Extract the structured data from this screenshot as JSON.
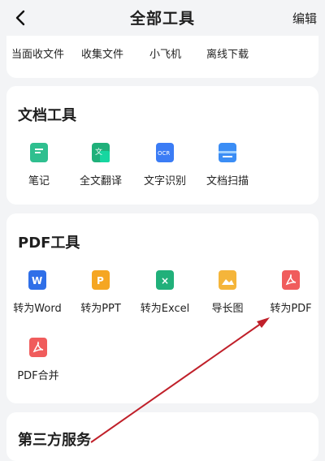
{
  "header": {
    "title": "全部工具",
    "edit_label": "编辑"
  },
  "top_row": [
    "当面收文件",
    "收集文件",
    "小飞机",
    "离线下载"
  ],
  "doc_section": {
    "title": "文档工具",
    "tools": [
      {
        "label": "笔记",
        "icon": "note-icon",
        "color": "#2fbf8f"
      },
      {
        "label": "全文翻译",
        "icon": "translate-icon",
        "color": "#1fb07a"
      },
      {
        "label": "文字识别",
        "icon": "ocr-icon",
        "color": "#3b7cf5"
      },
      {
        "label": "文档扫描",
        "icon": "scan-icon",
        "color": "#3b8df5"
      }
    ]
  },
  "pdf_section": {
    "title": "PDF工具",
    "tools": [
      {
        "label": "转为Word",
        "icon": "word-icon",
        "color": "#2f6fe8"
      },
      {
        "label": "转为PPT",
        "icon": "ppt-icon",
        "color": "#f5a623"
      },
      {
        "label": "转为Excel",
        "icon": "excel-icon",
        "color": "#21b07a"
      },
      {
        "label": "导长图",
        "icon": "long-image-icon",
        "color": "#f5b53a"
      },
      {
        "label": "转为PDF",
        "icon": "pdf-icon",
        "color": "#f05c5c"
      },
      {
        "label": "PDF合并",
        "icon": "pdf-merge-icon",
        "color": "#f05c5c"
      }
    ]
  },
  "third_section": {
    "title": "第三方服务"
  },
  "colors": {
    "annotation_arrow": "#c0202a"
  }
}
